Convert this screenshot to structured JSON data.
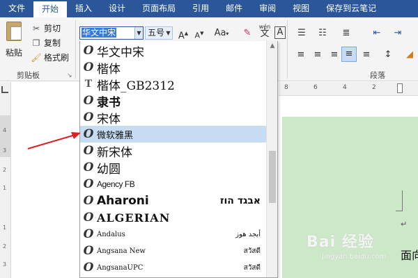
{
  "tabs": [
    "文件",
    "开始",
    "插入",
    "设计",
    "页面布局",
    "引用",
    "邮件",
    "审阅",
    "视图",
    "保存到云笔记"
  ],
  "active_tab": "开始",
  "clipboard": {
    "paste_label": "粘贴",
    "cut_label": "剪切",
    "copy_label": "复制",
    "format_painter_label": "格式刷",
    "group_label": "剪贴板"
  },
  "font": {
    "current_font": "华文中宋",
    "current_size": "五号",
    "wen_label": "wén",
    "wen_char": "文",
    "a_label": "A",
    "aa_label": "Aa"
  },
  "paragraph": {
    "group_label": "段落"
  },
  "ruler": {
    "h_labels": [
      "8",
      "6",
      "4",
      "2"
    ],
    "v_labels": [
      "4",
      "3",
      "2",
      "1",
      "1",
      "2",
      "3"
    ]
  },
  "document": {
    "snippet_text": "面向",
    "para_mark": "↵"
  },
  "font_list": [
    {
      "name": "华文中宋",
      "icon": "opentype-icon",
      "sample": ""
    },
    {
      "name": "楷体",
      "icon": "opentype-icon",
      "sample": ""
    },
    {
      "name": "楷体_GB2312",
      "icon": "truetype-icon",
      "sample": ""
    },
    {
      "name": "隶书",
      "icon": "opentype-icon",
      "sample": ""
    },
    {
      "name": "宋体",
      "icon": "opentype-icon",
      "sample": ""
    },
    {
      "name": "微软雅黑",
      "icon": "opentype-icon",
      "sample": ""
    },
    {
      "name": "新宋体",
      "icon": "opentype-icon",
      "sample": ""
    },
    {
      "name": "幼圆",
      "icon": "opentype-icon",
      "sample": ""
    },
    {
      "name": "Agency FB",
      "icon": "opentype-icon",
      "sample": ""
    },
    {
      "name": "Aharoni",
      "icon": "opentype-icon",
      "sample": "אבגד הוז"
    },
    {
      "name": "ALGERIAN",
      "icon": "opentype-icon",
      "sample": ""
    },
    {
      "name": "Andalus",
      "icon": "opentype-icon",
      "sample": "أبجد هوز"
    },
    {
      "name": "Angsana New",
      "icon": "opentype-icon",
      "sample": "สวัสดี"
    },
    {
      "name": "AngsanaUPC",
      "icon": "opentype-icon",
      "sample": "สวัสดี"
    }
  ],
  "highlighted_font": "微软雅黑",
  "watermark": {
    "logo": "Bai 经验",
    "url": "jingyan.baidu.com"
  },
  "colors": {
    "ribbon_blue": "#2b579a",
    "highlight": "#c5dcf2",
    "page_green": "#cde8c9",
    "annotation_red": "#e02020"
  }
}
